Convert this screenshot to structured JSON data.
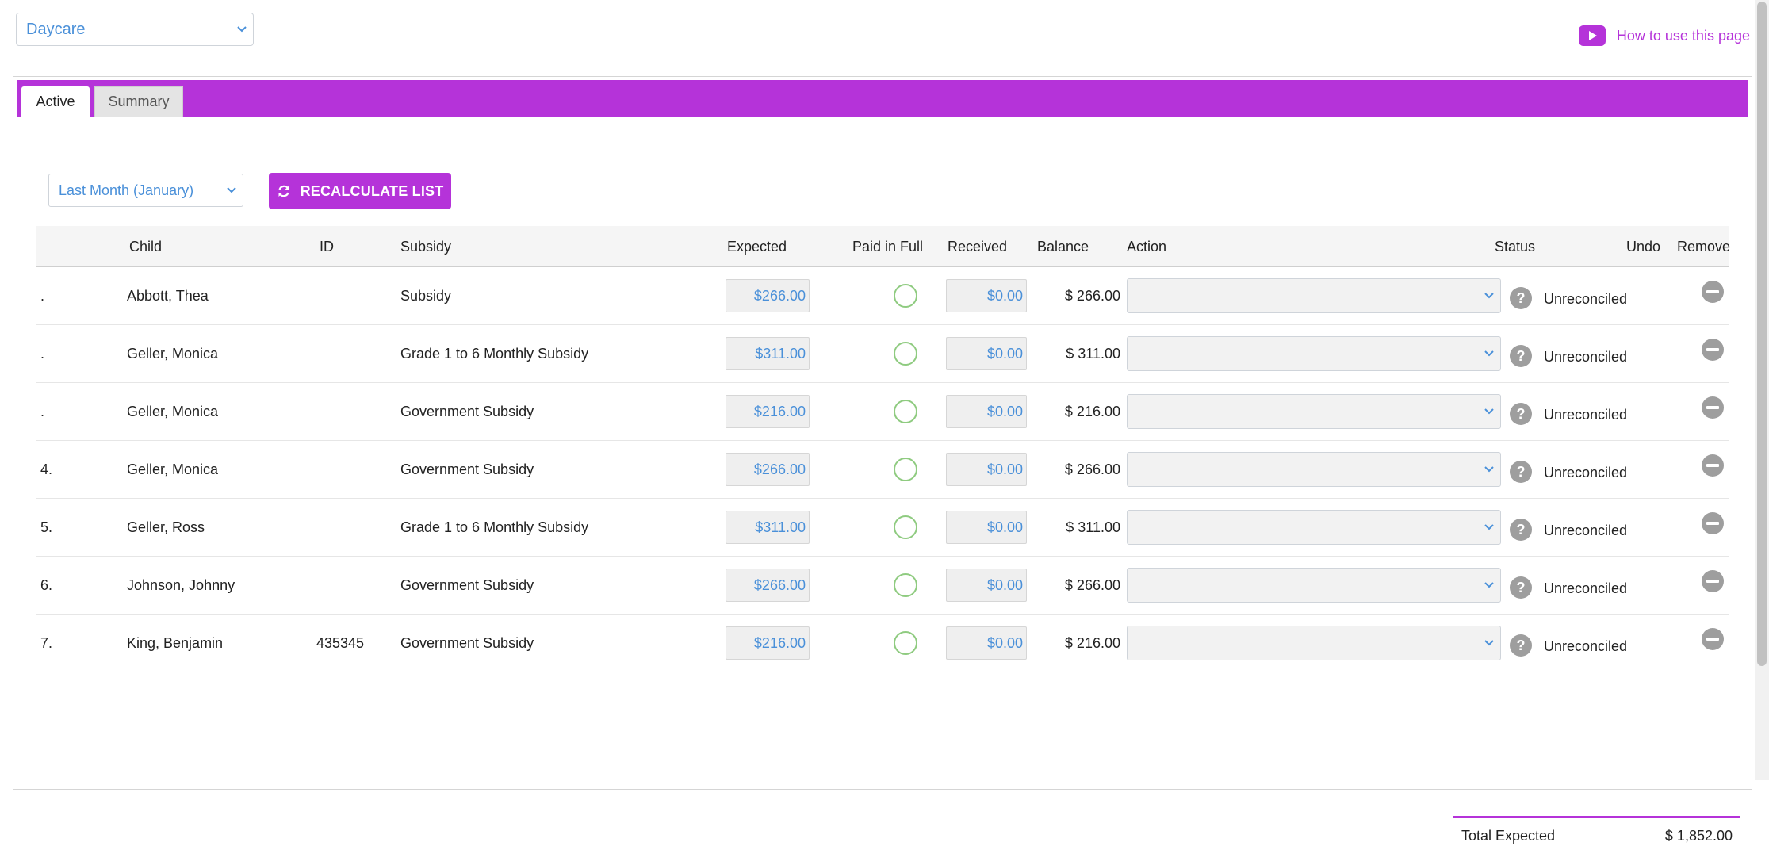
{
  "program": {
    "selected": "Daycare"
  },
  "help": {
    "label": "How to use this page",
    "icon": "youtube-play-icon"
  },
  "tabs": [
    {
      "label": "Active",
      "active": true
    },
    {
      "label": "Summary",
      "active": false
    }
  ],
  "period": {
    "selected": "Last Month (January)"
  },
  "recalculate": {
    "label": "RECALCULATE LIST",
    "icon": "refresh-icon"
  },
  "columns": {
    "child": "Child",
    "id": "ID",
    "subsidy": "Subsidy",
    "expected": "Expected",
    "paid_in_full": "Paid in Full",
    "received": "Received",
    "balance": "Balance",
    "action": "Action",
    "status": "Status",
    "undo": "Undo",
    "remove": "Remove"
  },
  "rows": [
    {
      "num": ".",
      "child": "Abbott, Thea",
      "id": "",
      "subsidy": "Subsidy",
      "expected": "$266.00",
      "received": "$0.00",
      "balance": "$ 266.00",
      "status": "Unreconciled"
    },
    {
      "num": ".",
      "child": "Geller, Monica",
      "id": "",
      "subsidy": "Grade 1 to 6 Monthly Subsidy",
      "expected": "$311.00",
      "received": "$0.00",
      "balance": "$ 311.00",
      "status": "Unreconciled"
    },
    {
      "num": ".",
      "child": "Geller, Monica",
      "id": "",
      "subsidy": "Government Subsidy",
      "expected": "$216.00",
      "received": "$0.00",
      "balance": "$ 216.00",
      "status": "Unreconciled"
    },
    {
      "num": "4.",
      "child": "Geller, Monica",
      "id": "",
      "subsidy": "Government Subsidy",
      "expected": "$266.00",
      "received": "$0.00",
      "balance": "$ 266.00",
      "status": "Unreconciled"
    },
    {
      "num": "5.",
      "child": "Geller, Ross",
      "id": "",
      "subsidy": "Grade 1 to 6 Monthly Subsidy",
      "expected": "$311.00",
      "received": "$0.00",
      "balance": "$ 311.00",
      "status": "Unreconciled"
    },
    {
      "num": "6.",
      "child": "Johnson, Johnny",
      "id": "",
      "subsidy": "Government Subsidy",
      "expected": "$266.00",
      "received": "$0.00",
      "balance": "$ 266.00",
      "status": "Unreconciled"
    },
    {
      "num": "7.",
      "child": "King, Benjamin",
      "id": "435345",
      "subsidy": "Government Subsidy",
      "expected": "$216.00",
      "received": "$0.00",
      "balance": "$ 216.00",
      "status": "Unreconciled"
    }
  ],
  "totals": {
    "label": "Total Expected",
    "value": "$ 1,852.00"
  },
  "colors": {
    "accent": "#b533d9",
    "link": "#4a90d9",
    "radio": "#8fcb80"
  }
}
